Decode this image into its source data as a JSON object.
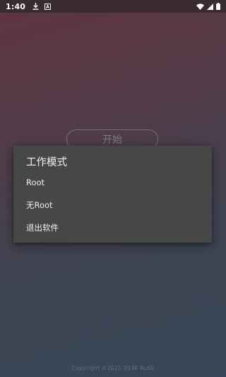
{
  "status_bar": {
    "time": "1:40",
    "icons": [
      "download-icon",
      "notification-a-icon",
      "wifi-icon",
      "cell-signal-icon",
      "battery-icon"
    ]
  },
  "main": {
    "start_button_label": "开始"
  },
  "dialog": {
    "title": "工作模式",
    "items": [
      {
        "label": "Root"
      },
      {
        "label": "无Root"
      },
      {
        "label": "退出软件"
      }
    ]
  },
  "footer": {
    "copyright": "Copyright ©2021-2030 RL60"
  },
  "colors": {
    "dialog_bg": "#474747",
    "status_bar_bg": "#3a2a31",
    "gradient_top": "#6a3b47",
    "gradient_bottom": "#3e4f62"
  }
}
